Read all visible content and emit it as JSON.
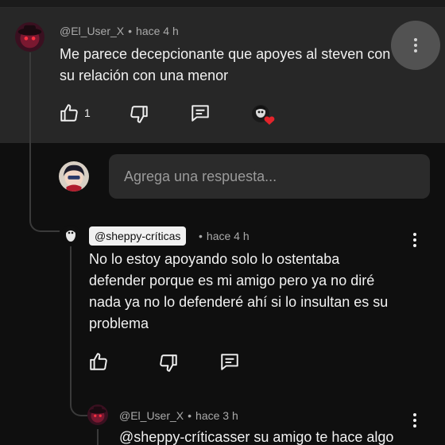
{
  "comment": {
    "author": "@El_User_X",
    "time": "hace 4 h",
    "separator": "•",
    "text_line1": "Me parece decepcionante que apoyes al steven con",
    "text_line2": "su relación con una menor",
    "like_count": "1"
  },
  "reply_box": {
    "placeholder": "Agrega una respuesta..."
  },
  "reply1": {
    "author": "@sheppy-críticas",
    "time": "hace 4 h",
    "separator": "•",
    "lines": [
      "No lo estoy apoyando solo lo ostentaba",
      "defender porque es mi amigo pero ya no diré",
      "nada ya no lo defenderé ahí si lo insultan es su",
      "problema"
    ]
  },
  "reply2": {
    "author": "@El_User_X",
    "time": "hace 3 h",
    "separator": "•",
    "text_line1": "@sheppy-críticasser su amigo te hace algo"
  },
  "colors": {
    "background": "#0f0f0f",
    "highlight": "#272727",
    "heart": "#e3242b"
  },
  "icons": [
    "like-icon",
    "dislike-icon",
    "reply-icon",
    "creator-heart-icon",
    "more-vert-icon"
  ]
}
